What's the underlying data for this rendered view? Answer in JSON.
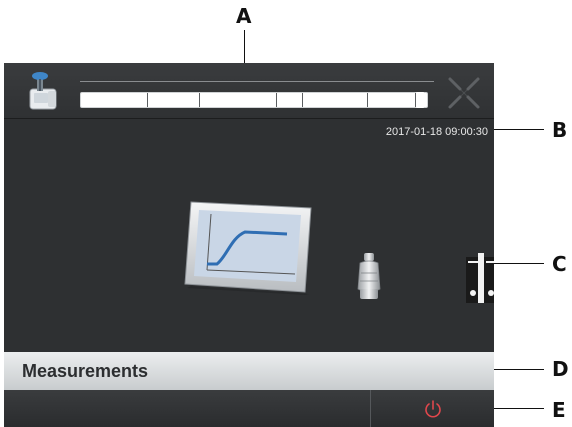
{
  "callouts": {
    "a": "A",
    "b": "B",
    "c": "C",
    "d": "D",
    "e": "E"
  },
  "header": {
    "device_icon": "instrument-icon",
    "progress_segments": 7,
    "close_icon": "close-icon"
  },
  "main": {
    "timestamp": "2017-01-18 09:00:30",
    "tiles": [
      {
        "name": "measurement-chart",
        "icon": "titration-curve-icon"
      },
      {
        "name": "reagent-bottle",
        "icon": "bottle-icon"
      },
      {
        "name": "archive-binders",
        "icon": "binders-icon"
      }
    ]
  },
  "title_bar": {
    "label": "Measurements"
  },
  "bottom_bar": {
    "power_icon": "power-icon",
    "power_color": "#e0474c"
  }
}
